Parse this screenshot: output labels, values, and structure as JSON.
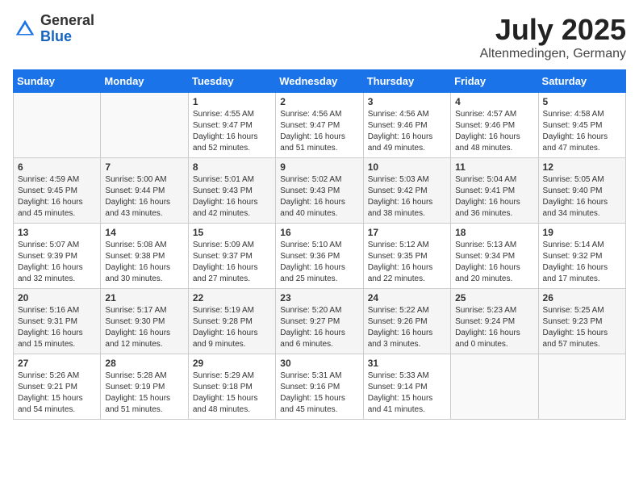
{
  "logo": {
    "general": "General",
    "blue": "Blue"
  },
  "title": "July 2025",
  "location": "Altenmedingen, Germany",
  "headers": [
    "Sunday",
    "Monday",
    "Tuesday",
    "Wednesday",
    "Thursday",
    "Friday",
    "Saturday"
  ],
  "weeks": [
    [
      {
        "day": "",
        "sunrise": "",
        "sunset": "",
        "daylight": ""
      },
      {
        "day": "",
        "sunrise": "",
        "sunset": "",
        "daylight": ""
      },
      {
        "day": "1",
        "sunrise": "Sunrise: 4:55 AM",
        "sunset": "Sunset: 9:47 PM",
        "daylight": "Daylight: 16 hours and 52 minutes."
      },
      {
        "day": "2",
        "sunrise": "Sunrise: 4:56 AM",
        "sunset": "Sunset: 9:47 PM",
        "daylight": "Daylight: 16 hours and 51 minutes."
      },
      {
        "day": "3",
        "sunrise": "Sunrise: 4:56 AM",
        "sunset": "Sunset: 9:46 PM",
        "daylight": "Daylight: 16 hours and 49 minutes."
      },
      {
        "day": "4",
        "sunrise": "Sunrise: 4:57 AM",
        "sunset": "Sunset: 9:46 PM",
        "daylight": "Daylight: 16 hours and 48 minutes."
      },
      {
        "day": "5",
        "sunrise": "Sunrise: 4:58 AM",
        "sunset": "Sunset: 9:45 PM",
        "daylight": "Daylight: 16 hours and 47 minutes."
      }
    ],
    [
      {
        "day": "6",
        "sunrise": "Sunrise: 4:59 AM",
        "sunset": "Sunset: 9:45 PM",
        "daylight": "Daylight: 16 hours and 45 minutes."
      },
      {
        "day": "7",
        "sunrise": "Sunrise: 5:00 AM",
        "sunset": "Sunset: 9:44 PM",
        "daylight": "Daylight: 16 hours and 43 minutes."
      },
      {
        "day": "8",
        "sunrise": "Sunrise: 5:01 AM",
        "sunset": "Sunset: 9:43 PM",
        "daylight": "Daylight: 16 hours and 42 minutes."
      },
      {
        "day": "9",
        "sunrise": "Sunrise: 5:02 AM",
        "sunset": "Sunset: 9:43 PM",
        "daylight": "Daylight: 16 hours and 40 minutes."
      },
      {
        "day": "10",
        "sunrise": "Sunrise: 5:03 AM",
        "sunset": "Sunset: 9:42 PM",
        "daylight": "Daylight: 16 hours and 38 minutes."
      },
      {
        "day": "11",
        "sunrise": "Sunrise: 5:04 AM",
        "sunset": "Sunset: 9:41 PM",
        "daylight": "Daylight: 16 hours and 36 minutes."
      },
      {
        "day": "12",
        "sunrise": "Sunrise: 5:05 AM",
        "sunset": "Sunset: 9:40 PM",
        "daylight": "Daylight: 16 hours and 34 minutes."
      }
    ],
    [
      {
        "day": "13",
        "sunrise": "Sunrise: 5:07 AM",
        "sunset": "Sunset: 9:39 PM",
        "daylight": "Daylight: 16 hours and 32 minutes."
      },
      {
        "day": "14",
        "sunrise": "Sunrise: 5:08 AM",
        "sunset": "Sunset: 9:38 PM",
        "daylight": "Daylight: 16 hours and 30 minutes."
      },
      {
        "day": "15",
        "sunrise": "Sunrise: 5:09 AM",
        "sunset": "Sunset: 9:37 PM",
        "daylight": "Daylight: 16 hours and 27 minutes."
      },
      {
        "day": "16",
        "sunrise": "Sunrise: 5:10 AM",
        "sunset": "Sunset: 9:36 PM",
        "daylight": "Daylight: 16 hours and 25 minutes."
      },
      {
        "day": "17",
        "sunrise": "Sunrise: 5:12 AM",
        "sunset": "Sunset: 9:35 PM",
        "daylight": "Daylight: 16 hours and 22 minutes."
      },
      {
        "day": "18",
        "sunrise": "Sunrise: 5:13 AM",
        "sunset": "Sunset: 9:34 PM",
        "daylight": "Daylight: 16 hours and 20 minutes."
      },
      {
        "day": "19",
        "sunrise": "Sunrise: 5:14 AM",
        "sunset": "Sunset: 9:32 PM",
        "daylight": "Daylight: 16 hours and 17 minutes."
      }
    ],
    [
      {
        "day": "20",
        "sunrise": "Sunrise: 5:16 AM",
        "sunset": "Sunset: 9:31 PM",
        "daylight": "Daylight: 16 hours and 15 minutes."
      },
      {
        "day": "21",
        "sunrise": "Sunrise: 5:17 AM",
        "sunset": "Sunset: 9:30 PM",
        "daylight": "Daylight: 16 hours and 12 minutes."
      },
      {
        "day": "22",
        "sunrise": "Sunrise: 5:19 AM",
        "sunset": "Sunset: 9:28 PM",
        "daylight": "Daylight: 16 hours and 9 minutes."
      },
      {
        "day": "23",
        "sunrise": "Sunrise: 5:20 AM",
        "sunset": "Sunset: 9:27 PM",
        "daylight": "Daylight: 16 hours and 6 minutes."
      },
      {
        "day": "24",
        "sunrise": "Sunrise: 5:22 AM",
        "sunset": "Sunset: 9:26 PM",
        "daylight": "Daylight: 16 hours and 3 minutes."
      },
      {
        "day": "25",
        "sunrise": "Sunrise: 5:23 AM",
        "sunset": "Sunset: 9:24 PM",
        "daylight": "Daylight: 16 hours and 0 minutes."
      },
      {
        "day": "26",
        "sunrise": "Sunrise: 5:25 AM",
        "sunset": "Sunset: 9:23 PM",
        "daylight": "Daylight: 15 hours and 57 minutes."
      }
    ],
    [
      {
        "day": "27",
        "sunrise": "Sunrise: 5:26 AM",
        "sunset": "Sunset: 9:21 PM",
        "daylight": "Daylight: 15 hours and 54 minutes."
      },
      {
        "day": "28",
        "sunrise": "Sunrise: 5:28 AM",
        "sunset": "Sunset: 9:19 PM",
        "daylight": "Daylight: 15 hours and 51 minutes."
      },
      {
        "day": "29",
        "sunrise": "Sunrise: 5:29 AM",
        "sunset": "Sunset: 9:18 PM",
        "daylight": "Daylight: 15 hours and 48 minutes."
      },
      {
        "day": "30",
        "sunrise": "Sunrise: 5:31 AM",
        "sunset": "Sunset: 9:16 PM",
        "daylight": "Daylight: 15 hours and 45 minutes."
      },
      {
        "day": "31",
        "sunrise": "Sunrise: 5:33 AM",
        "sunset": "Sunset: 9:14 PM",
        "daylight": "Daylight: 15 hours and 41 minutes."
      },
      {
        "day": "",
        "sunrise": "",
        "sunset": "",
        "daylight": ""
      },
      {
        "day": "",
        "sunrise": "",
        "sunset": "",
        "daylight": ""
      }
    ]
  ]
}
